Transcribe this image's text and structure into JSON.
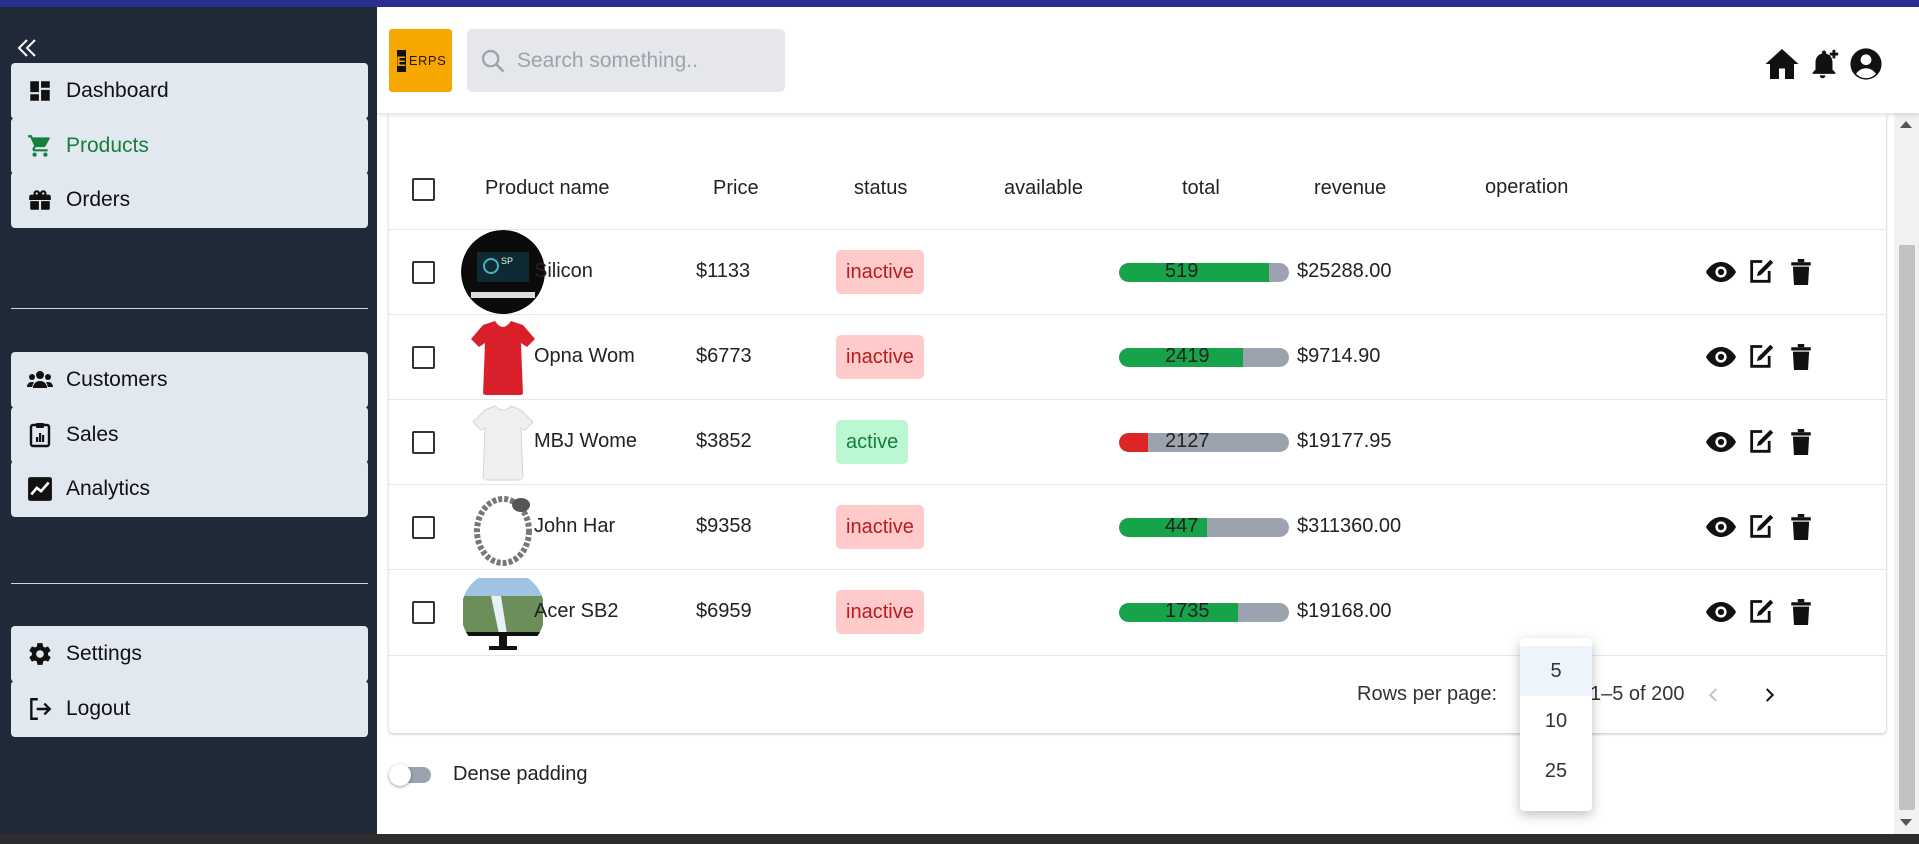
{
  "app": {
    "logo_text": "ERPS",
    "logo_mark": "E"
  },
  "search": {
    "placeholder": "Search something.."
  },
  "sidebar": {
    "items": [
      {
        "label": "Dashboard",
        "icon": "dashboard-icon"
      },
      {
        "label": "Products",
        "icon": "cart-icon",
        "active": true
      },
      {
        "label": "Orders",
        "icon": "gift-icon"
      },
      {
        "label": "Customers",
        "icon": "users-icon"
      },
      {
        "label": "Sales",
        "icon": "clipboard-icon"
      },
      {
        "label": "Analytics",
        "icon": "chart-line-icon"
      },
      {
        "label": "Settings",
        "icon": "gear-icon"
      },
      {
        "label": "Logout",
        "icon": "logout-icon"
      }
    ]
  },
  "header_icons": [
    "home-icon",
    "bell-plus-icon",
    "user-circle-icon"
  ],
  "table": {
    "columns": [
      "Product name",
      "Price",
      "status",
      "available",
      "total",
      "revenue",
      "operation"
    ],
    "rows": [
      {
        "name": "Silicon",
        "price": "$1133",
        "status": "inactive",
        "available": 0.88,
        "total": "519",
        "revenue": "$25288.00"
      },
      {
        "name": "Opna Wom",
        "price": "$6773",
        "status": "inactive",
        "available": 0.73,
        "total": "2419",
        "revenue": "$9714.90"
      },
      {
        "name": "MBJ Wome",
        "price": "$3852",
        "status": "active",
        "available": 0.17,
        "total": "2127",
        "revenue": "$19177.95"
      },
      {
        "name": "John Har",
        "price": "$9358",
        "status": "inactive",
        "available": 0.52,
        "total": "447",
        "revenue": "$311360.00"
      },
      {
        "name": "Acer SB2",
        "price": "$6959",
        "status": "inactive",
        "available": 0.7,
        "total": "1735",
        "revenue": "$19168.00"
      }
    ]
  },
  "pagination": {
    "rows_per_page_label": "Rows per page:",
    "range": "1–5 of 200",
    "options": [
      "5",
      "10",
      "25"
    ],
    "selected": "5"
  },
  "dense_padding": {
    "label": "Dense padding",
    "on": false
  },
  "colors": {
    "sidebar_bg": "#1f2937",
    "active_green": "#15803d",
    "bar_green": "#16a34a",
    "bar_red": "#dc2626",
    "inactive_bg": "#fecaca",
    "active_bg": "#bbf7d0"
  }
}
